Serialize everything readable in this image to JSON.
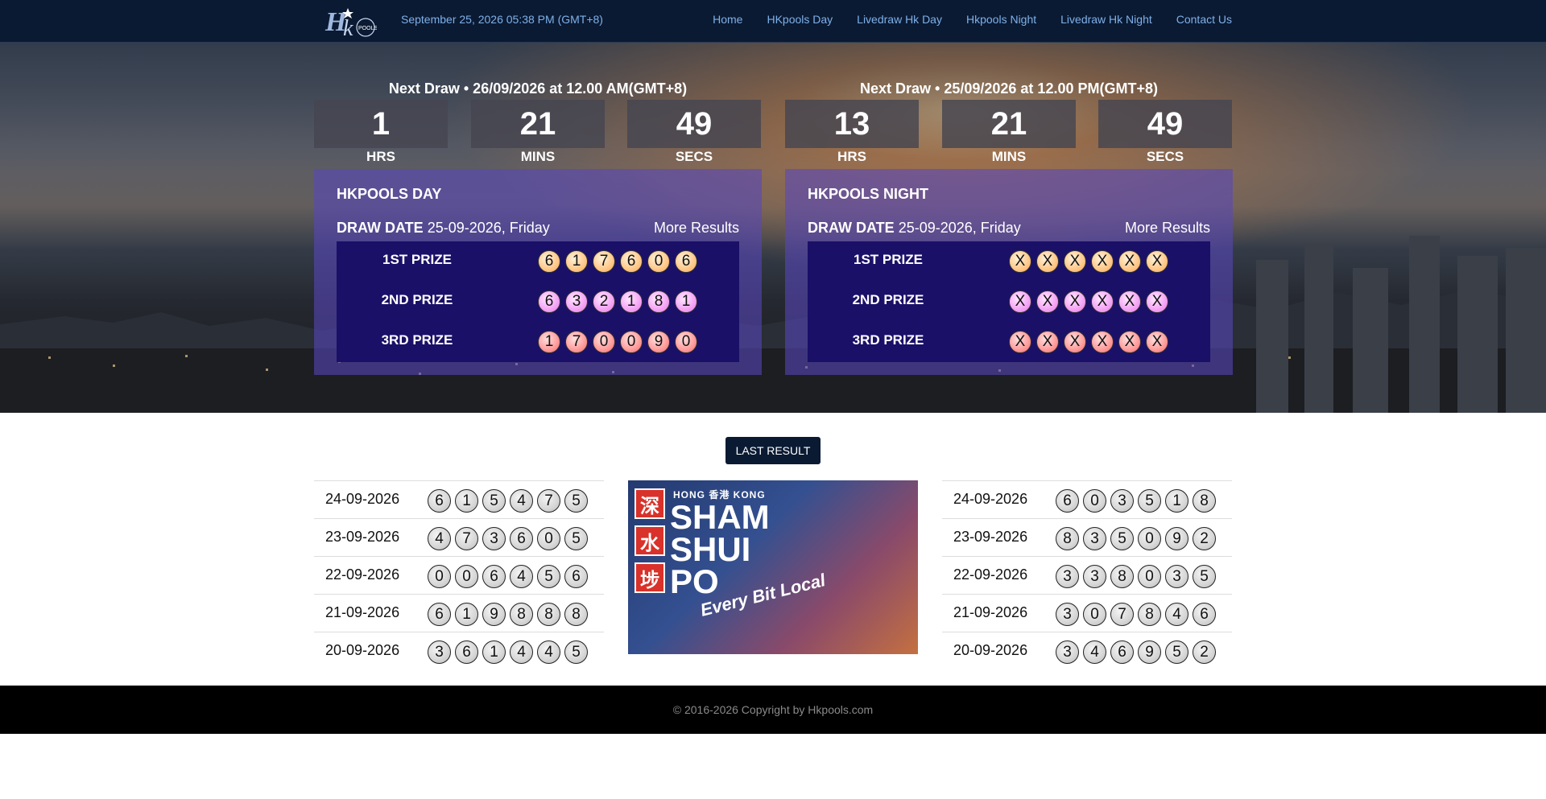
{
  "header": {
    "logo_text": "HK POOLS",
    "datetime": "September 25, 2026 05:38 PM (GMT+8)",
    "nav": [
      {
        "label": "Home"
      },
      {
        "label": "HKpools Day"
      },
      {
        "label": "Livedraw Hk Day"
      },
      {
        "label": "Hkpools Night"
      },
      {
        "label": "Livedraw Hk Night"
      },
      {
        "label": "Contact Us"
      }
    ]
  },
  "day": {
    "next_draw": "Next Draw • 26/09/2026 at 12.00 AM(GMT+8)",
    "countdown": {
      "hrs": "1",
      "mins": "21",
      "secs": "49"
    },
    "labels": {
      "hrs": "HRS",
      "mins": "MINS",
      "secs": "SECS"
    },
    "title": "HKPOOLS DAY",
    "draw_date_label": "DRAW DATE",
    "draw_date": "25-09-2026, Friday",
    "more_results": "More Results",
    "prizes": [
      {
        "name": "1ST PRIZE",
        "balls": [
          "6",
          "1",
          "7",
          "6",
          "0",
          "6"
        ]
      },
      {
        "name": "2ND PRIZE",
        "balls": [
          "6",
          "3",
          "2",
          "1",
          "8",
          "1"
        ]
      },
      {
        "name": "3RD PRIZE",
        "balls": [
          "1",
          "7",
          "0",
          "0",
          "9",
          "0"
        ]
      }
    ]
  },
  "night": {
    "next_draw": "Next Draw • 25/09/2026 at 12.00 PM(GMT+8)",
    "countdown": {
      "hrs": "13",
      "mins": "21",
      "secs": "49"
    },
    "labels": {
      "hrs": "HRS",
      "mins": "MINS",
      "secs": "SECS"
    },
    "title": "HKPOOLS NIGHT",
    "draw_date_label": "DRAW DATE",
    "draw_date": "25-09-2026, Friday",
    "more_results": "More Results",
    "prizes": [
      {
        "name": "1ST PRIZE",
        "balls": [
          "X",
          "X",
          "X",
          "X",
          "X",
          "X"
        ]
      },
      {
        "name": "2ND PRIZE",
        "balls": [
          "X",
          "X",
          "X",
          "X",
          "X",
          "X"
        ]
      },
      {
        "name": "3RD PRIZE",
        "balls": [
          "X",
          "X",
          "X",
          "X",
          "X",
          "X"
        ]
      }
    ]
  },
  "last_result_button": "LAST RESULT",
  "last_results_day": [
    {
      "date": "24-09-2026",
      "balls": [
        "6",
        "1",
        "5",
        "4",
        "7",
        "5"
      ]
    },
    {
      "date": "23-09-2026",
      "balls": [
        "4",
        "7",
        "3",
        "6",
        "0",
        "5"
      ]
    },
    {
      "date": "22-09-2026",
      "balls": [
        "0",
        "0",
        "6",
        "4",
        "5",
        "6"
      ]
    },
    {
      "date": "21-09-2026",
      "balls": [
        "6",
        "1",
        "9",
        "8",
        "8",
        "8"
      ]
    },
    {
      "date": "20-09-2026",
      "balls": [
        "3",
        "6",
        "1",
        "4",
        "4",
        "5"
      ]
    }
  ],
  "last_results_night": [
    {
      "date": "24-09-2026",
      "balls": [
        "6",
        "0",
        "3",
        "5",
        "1",
        "8"
      ]
    },
    {
      "date": "23-09-2026",
      "balls": [
        "8",
        "3",
        "5",
        "0",
        "9",
        "2"
      ]
    },
    {
      "date": "22-09-2026",
      "balls": [
        "3",
        "3",
        "8",
        "0",
        "3",
        "5"
      ]
    },
    {
      "date": "21-09-2026",
      "balls": [
        "3",
        "0",
        "7",
        "8",
        "4",
        "6"
      ]
    },
    {
      "date": "20-09-2026",
      "balls": [
        "3",
        "4",
        "6",
        "9",
        "5",
        "2"
      ]
    }
  ],
  "promo": {
    "tag": "HONG 香港 KONG",
    "line1": "SHAM",
    "line2": "SHUI",
    "line3": "PO",
    "tagline": "Every Bit Local",
    "stamps": [
      "深",
      "水",
      "埗"
    ]
  },
  "footer": {
    "copyright": "© 2016-2026 Copyright by Hkpools.com"
  },
  "colors": {
    "navbar": "#0a1a33",
    "nav_link": "#7fb0e8",
    "card": "#5846be",
    "prize_table": "#1a1068"
  }
}
